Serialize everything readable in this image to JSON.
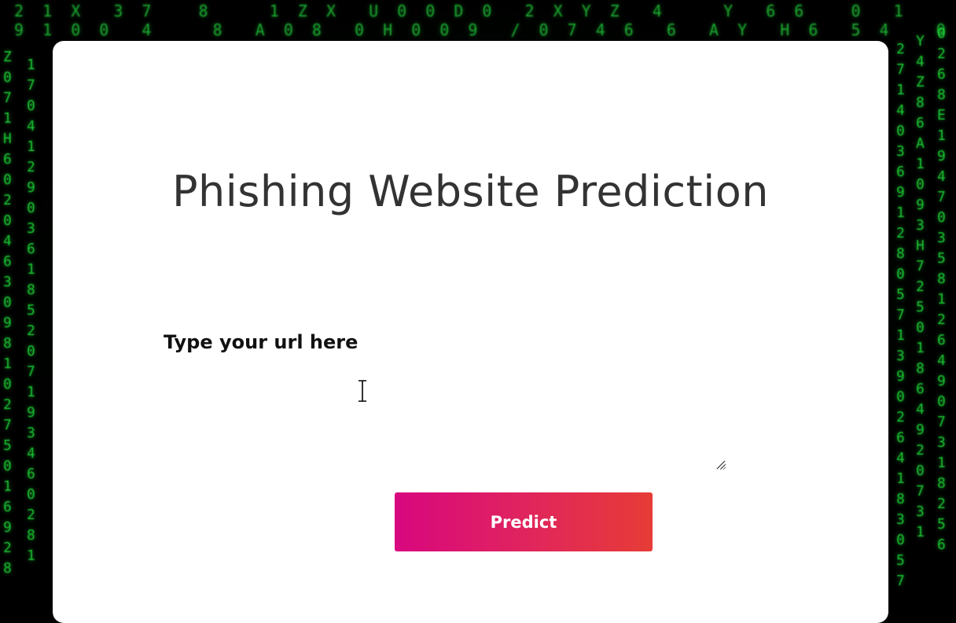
{
  "page": {
    "title": "Phishing Website Prediction"
  },
  "form": {
    "url_label": "Type your url here",
    "url_value": "",
    "submit_label": "Predict"
  },
  "colors": {
    "page_background": "#000000",
    "matrix_green": "#1ee23a",
    "card_background": "#ffffff",
    "title_text": "#333333",
    "button_gradient_start": "#d8077f",
    "button_gradient_end": "#e73c36",
    "button_text": "#ffffff"
  },
  "icons": {
    "cursor": "text-cursor-icon",
    "textarea_resize": "resize-grip-icon"
  }
}
